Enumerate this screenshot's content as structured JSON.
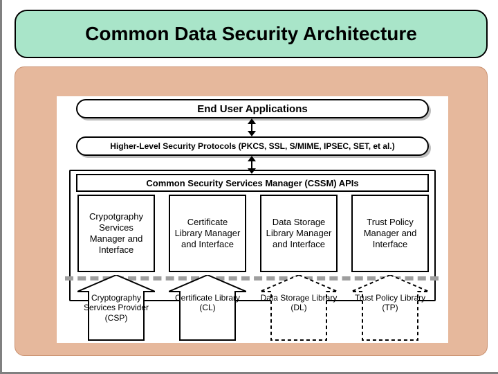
{
  "title": "Common Data Security Architecture",
  "layers": {
    "end_user": "End User Applications",
    "protocols": "Higher-Level Security Protocols (PKCS, SSL, S/MIME, IPSEC, SET, et al.)",
    "cssm": "Common Security Services Manager (CSSM) APIs"
  },
  "managers": [
    "Crypotgraphy Services Manager and Interface",
    "Certificate Library Manager and Interface",
    "Data Storage Library Manager and Interface",
    "Trust Policy Manager and Interface"
  ],
  "providers": [
    {
      "label": "Cryptography Services Provider (CSP)",
      "style": "solid"
    },
    {
      "label": "Certificate Library (CL)",
      "style": "solid"
    },
    {
      "label": "Data Storage Library (DL)",
      "style": "dashed"
    },
    {
      "label": "Trust Policy Library (TP)",
      "style": "dashed"
    }
  ]
}
